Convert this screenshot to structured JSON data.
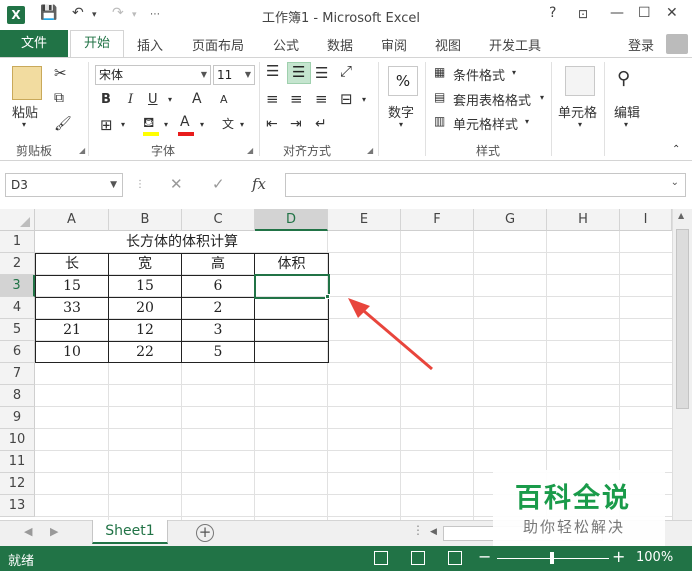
{
  "window": {
    "title": "工作簿1 - Microsoft Excel",
    "help": "?",
    "controls": [
      "—",
      "☐",
      "✕"
    ]
  },
  "ribbon_tabs": [
    "文件",
    "开始",
    "插入",
    "页面布局",
    "公式",
    "数据",
    "审阅",
    "视图",
    "开发工具"
  ],
  "login": "登录",
  "ribbon": {
    "clipboard": {
      "paste": "粘贴",
      "label": "剪贴板"
    },
    "font": {
      "name": "宋体",
      "size": "11",
      "label": "字体",
      "bold": "B",
      "italic": "I",
      "underline": "U",
      "grow": "A",
      "shrink": "A",
      "phonetic": "文"
    },
    "alignment": {
      "label": "对齐方式"
    },
    "number": {
      "btn": "数字",
      "symbol": "%"
    },
    "styles": {
      "cond": "条件格式",
      "table": "套用表格格式",
      "cell": "单元格样式",
      "label": "样式"
    },
    "cells": {
      "btn": "单元格"
    },
    "editing": {
      "btn": "编辑"
    }
  },
  "formula_bar": {
    "name_box": "D3",
    "fx": "fx",
    "value": ""
  },
  "columns": [
    "A",
    "B",
    "C",
    "D",
    "E",
    "F",
    "G",
    "H",
    "I"
  ],
  "rows": [
    "1",
    "2",
    "3",
    "4",
    "5",
    "6",
    "7",
    "8",
    "9",
    "10",
    "11",
    "12",
    "13"
  ],
  "table": {
    "title": "长方体的体积计算",
    "headers": [
      "长",
      "宽",
      "高",
      "体积"
    ],
    "data": [
      [
        "15",
        "15",
        "6"
      ],
      [
        "33",
        "20",
        "2"
      ],
      [
        "21",
        "12",
        "3"
      ],
      [
        "10",
        "22",
        "5"
      ]
    ]
  },
  "sheet_tab": "Sheet1",
  "add_sheet": "+",
  "status": {
    "text": "就绪",
    "zoom": "100%",
    "minus": "−",
    "plus": "+"
  },
  "watermark": {
    "title": "百科全说",
    "subtitle": "助你轻松解决"
  },
  "colors": {
    "excel_green": "#217346",
    "arrow_red": "#e8453c"
  }
}
